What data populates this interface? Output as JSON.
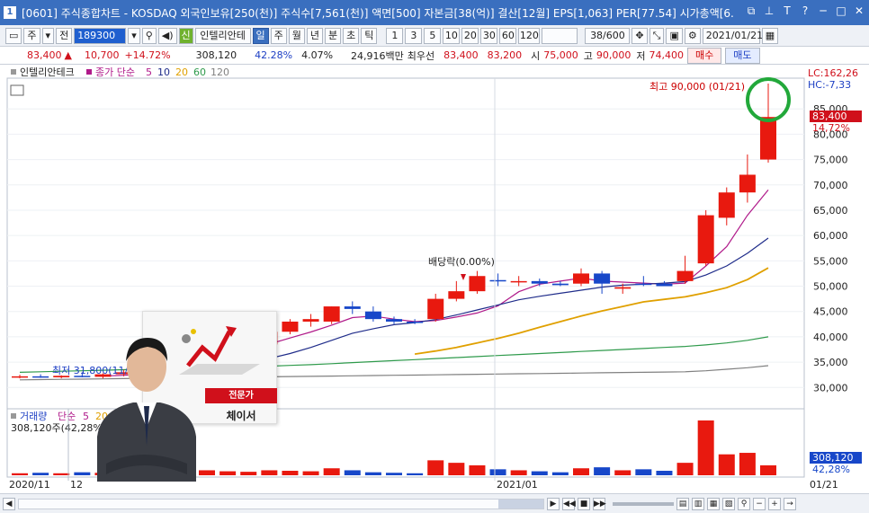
{
  "window": {
    "title": "[0601] 주식종합차트 - KOSDAQ 외국인보유[250(천)] 주식수[7,561(천)] 액면[500] 자본금[38(억)] 결산[12월] EPS[1,063] PER[77.54] 시가총액[6.",
    "app_icon_label": "1"
  },
  "toolbar": {
    "mode_label": "주",
    "prev_label": "전",
    "code_value": "189300",
    "badge_label": "신",
    "stock_name": "인텔리안테",
    "period_buttons": [
      "일",
      "주",
      "월",
      "년",
      "분",
      "초",
      "틱"
    ],
    "selected_period": "일",
    "interval_buttons": [
      "1",
      "3",
      "5",
      "10",
      "20",
      "30",
      "60",
      "120"
    ],
    "count_value": "38/600",
    "date_value": "2021/01/21"
  },
  "quote": {
    "price": "83,400",
    "change": "10,700",
    "change_pct": "+14.72%",
    "volume": "308,120",
    "turnover_pct": "42.28%",
    "other_pct": "4.07%",
    "amount": "24,916백만",
    "best_label": "최우선",
    "best_ask": "83,400",
    "best_bid": "83,200",
    "open_label": "시",
    "open": "75,000",
    "high_label": "고",
    "high": "90,000",
    "low_label": "저",
    "low": "74,400",
    "buy_label": "매수",
    "sell_label": "매도"
  },
  "legend": {
    "stock_name": "인텔리안테크",
    "ma_label": "종가 단순",
    "ma_periods": [
      "5",
      "10",
      "20",
      "60",
      "120"
    ],
    "ma_colors": [
      "#b01a8a",
      "#1f2c8a",
      "#e0a000",
      "#2e9a4b",
      "#808080"
    ]
  },
  "vol_legend": {
    "label": "거래량",
    "ma_label": "단순",
    "ma_periods": [
      "5",
      "20"
    ],
    "value_text": "308,120주(42,28%)"
  },
  "annotations": {
    "high_note": "최고 90,000 (01/21)",
    "low_note": "최저 31,800(11/",
    "dividend": "배당락(0.00%)",
    "lc": "LC:162,26",
    "hc": "HC:-7,33",
    "price_tag": "83,400",
    "pct_tag": "14,72%",
    "vol_tag": "308,120",
    "vol_pct_tag": "42,28%"
  },
  "promo": {
    "badge": "전문가",
    "name": "체이서"
  },
  "colors": {
    "up": "#e8190f",
    "down": "#1747c9",
    "titlebar": "#3a6fbf"
  },
  "chart_data": {
    "type": "candlestick",
    "y_ticks": [
      "85,000",
      "80,000",
      "75,000",
      "70,000",
      "65,000",
      "60,000",
      "55,000",
      "50,000",
      "45,000",
      "40,000",
      "35,000",
      "30,000"
    ],
    "y_range": [
      26500,
      90000
    ],
    "x_labels": [
      "2020/11",
      "12",
      "2021/01",
      "01/21"
    ],
    "candles": [
      {
        "o": 32000,
        "h": 32500,
        "l": 31800,
        "c": 32200
      },
      {
        "o": 32200,
        "h": 32600,
        "l": 31900,
        "c": 32000
      },
      {
        "o": 32000,
        "h": 32400,
        "l": 31800,
        "c": 32300
      },
      {
        "o": 32300,
        "h": 33000,
        "l": 32000,
        "c": 32100
      },
      {
        "o": 32100,
        "h": 32800,
        "l": 31800,
        "c": 32600
      },
      {
        "o": 32600,
        "h": 33500,
        "l": 32200,
        "c": 33000
      },
      {
        "o": 33000,
        "h": 33800,
        "l": 32600,
        "c": 32800
      },
      {
        "o": 33000,
        "h": 35000,
        "l": 32800,
        "c": 34500
      },
      {
        "o": 34800,
        "h": 37500,
        "l": 34500,
        "c": 37000
      },
      {
        "o": 37000,
        "h": 38500,
        "l": 36000,
        "c": 37500
      },
      {
        "o": 37500,
        "h": 39000,
        "l": 37000,
        "c": 38300
      },
      {
        "o": 38300,
        "h": 39500,
        "l": 37800,
        "c": 39000
      },
      {
        "o": 38500,
        "h": 41500,
        "l": 38000,
        "c": 41000
      },
      {
        "o": 41000,
        "h": 43500,
        "l": 40500,
        "c": 43000
      },
      {
        "o": 43000,
        "h": 44500,
        "l": 42000,
        "c": 43500
      },
      {
        "o": 43000,
        "h": 46000,
        "l": 42500,
        "c": 46000
      },
      {
        "o": 46000,
        "h": 47000,
        "l": 44500,
        "c": 45500
      },
      {
        "o": 45000,
        "h": 46000,
        "l": 43000,
        "c": 43500
      },
      {
        "o": 43500,
        "h": 44000,
        "l": 42500,
        "c": 43000
      },
      {
        "o": 43000,
        "h": 43500,
        "l": 42500,
        "c": 42800
      },
      {
        "o": 43500,
        "h": 48500,
        "l": 43000,
        "c": 47500
      },
      {
        "o": 47500,
        "h": 51000,
        "l": 47000,
        "c": 49000
      },
      {
        "o": 49000,
        "h": 53000,
        "l": 48500,
        "c": 52000
      },
      {
        "o": 51200,
        "h": 52500,
        "l": 50000,
        "c": 51000
      },
      {
        "o": 51000,
        "h": 52000,
        "l": 50000,
        "c": 51000
      },
      {
        "o": 51000,
        "h": 51500,
        "l": 50000,
        "c": 50500
      },
      {
        "o": 50500,
        "h": 51000,
        "l": 50000,
        "c": 50200
      },
      {
        "o": 50500,
        "h": 53500,
        "l": 50000,
        "c": 52500
      },
      {
        "o": 52500,
        "h": 53000,
        "l": 48500,
        "c": 50500
      },
      {
        "o": 49500,
        "h": 50500,
        "l": 48500,
        "c": 49800
      },
      {
        "o": 50500,
        "h": 52000,
        "l": 50000,
        "c": 50300
      },
      {
        "o": 50500,
        "h": 51000,
        "l": 50000,
        "c": 50000
      },
      {
        "o": 51000,
        "h": 56000,
        "l": 50500,
        "c": 53000
      },
      {
        "o": 54500,
        "h": 65000,
        "l": 54000,
        "c": 64000
      },
      {
        "o": 63500,
        "h": 69500,
        "l": 62000,
        "c": 68500
      },
      {
        "o": 68500,
        "h": 76000,
        "l": 66500,
        "c": 72000
      },
      {
        "o": 75000,
        "h": 90000,
        "l": 74400,
        "c": 83400
      }
    ],
    "volumes": [
      4,
      5,
      4,
      6,
      5,
      7,
      5,
      9,
      12,
      10,
      8,
      7,
      10,
      9,
      8,
      14,
      10,
      6,
      5,
      4,
      30,
      25,
      20,
      12,
      10,
      8,
      6,
      14,
      16,
      10,
      12,
      9,
      25,
      110,
      42,
      45,
      20
    ],
    "ma": [
      {
        "period": "5",
        "color": "#b01a8a",
        "values": [
          null,
          null,
          null,
          null,
          32240,
          32400,
          32560,
          32800,
          33780,
          34960,
          36100,
          37260,
          38560,
          39760,
          40960,
          42300,
          43800,
          44100,
          43500,
          43000,
          43200,
          43900,
          44700,
          46100,
          48900,
          50400,
          51000,
          51600,
          51000,
          50800,
          50600,
          50400,
          50600,
          54000,
          57800,
          64000,
          69000
        ]
      },
      {
        "period": "10",
        "color": "#1f2c8a",
        "values": [
          null,
          null,
          null,
          null,
          null,
          null,
          null,
          null,
          null,
          33500,
          34100,
          34800,
          35700,
          36700,
          37900,
          39300,
          40700,
          41600,
          42400,
          42800,
          43400,
          44300,
          45300,
          46300,
          47300,
          48000,
          48600,
          49200,
          49800,
          50200,
          50400,
          50600,
          50900,
          52200,
          54000,
          56500,
          59500
        ]
      },
      {
        "period": "20",
        "color": "#e0a000",
        "values": [
          null,
          null,
          null,
          null,
          null,
          null,
          null,
          null,
          null,
          null,
          null,
          null,
          null,
          null,
          null,
          null,
          null,
          null,
          null,
          36600,
          37200,
          37900,
          38800,
          39700,
          40700,
          41900,
          43000,
          44100,
          45100,
          46000,
          46900,
          47400,
          47900,
          48700,
          49700,
          51300,
          53600
        ]
      },
      {
        "period": "60",
        "color": "#2e9a4b",
        "values": [
          33000,
          33100,
          33200,
          33300,
          33400,
          33500,
          33600,
          33700,
          33800,
          33900,
          34000,
          34100,
          34200,
          34350,
          34500,
          34700,
          34900,
          35100,
          35300,
          35500,
          35700,
          35900,
          36100,
          36300,
          36500,
          36700,
          36900,
          37100,
          37300,
          37500,
          37700,
          37900,
          38100,
          38400,
          38800,
          39300,
          40000
        ]
      },
      {
        "period": "120",
        "color": "#808080",
        "values": [
          31500,
          31550,
          31600,
          31650,
          31700,
          31750,
          31800,
          31850,
          31900,
          31950,
          32000,
          32050,
          32100,
          32150,
          32200,
          32250,
          32300,
          32350,
          32400,
          32450,
          32500,
          32550,
          32600,
          32650,
          32700,
          32750,
          32800,
          32850,
          32900,
          32950,
          33000,
          33050,
          33100,
          33300,
          33600,
          33900,
          34300
        ]
      }
    ]
  }
}
